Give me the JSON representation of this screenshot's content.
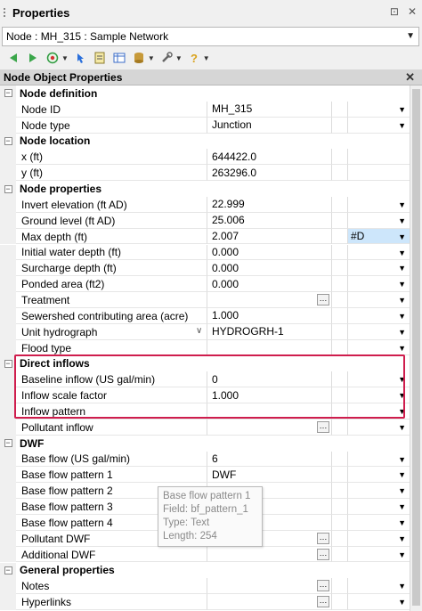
{
  "panel": {
    "title": "Properties",
    "pin_glyph": "⊡",
    "close_glyph": "✕"
  },
  "node_selector": {
    "value": "Node : MH_315 : Sample Network"
  },
  "toolbar": {
    "icons": [
      "back-icon",
      "forward-icon",
      "record-icon",
      "pointer-icon",
      "note-icon",
      "table-icon",
      "database-icon",
      "wrench-icon",
      "help-icon"
    ]
  },
  "grid_header": {
    "label": "Node Object Properties",
    "close_glyph": "✕"
  },
  "groups": {
    "node_definition": "Node definition",
    "node_location": "Node location",
    "node_properties": "Node properties",
    "direct_inflows": "Direct inflows",
    "dwf": "DWF",
    "general_properties": "General properties"
  },
  "props": {
    "node_id": {
      "name": "Node ID",
      "value": "MH_315"
    },
    "node_type": {
      "name": "Node type",
      "value": "Junction"
    },
    "x": {
      "name": "x (ft)",
      "value": "644422.0"
    },
    "y": {
      "name": "y (ft)",
      "value": "263296.0"
    },
    "invert": {
      "name": "Invert elevation (ft AD)",
      "value": "22.999"
    },
    "ground": {
      "name": "Ground level (ft AD)",
      "value": "25.006"
    },
    "maxdepth": {
      "name": "Max depth (ft)",
      "value": "2.007",
      "flag": "#D"
    },
    "initdepth": {
      "name": "Initial water depth (ft)",
      "value": "0.000"
    },
    "surcharge": {
      "name": "Surcharge depth (ft)",
      "value": "0.000"
    },
    "ponded": {
      "name": "Ponded area (ft2)",
      "value": "0.000"
    },
    "treatment": {
      "name": "Treatment",
      "value": ""
    },
    "sewershed": {
      "name": "Sewershed contributing area (acre)",
      "value": "1.000"
    },
    "unithydro": {
      "name": "Unit hydrograph",
      "value": "HYDROGRH-1"
    },
    "floodtype": {
      "name": "Flood type",
      "value": ""
    },
    "baseline": {
      "name": "Baseline inflow (US gal/min)",
      "value": "0"
    },
    "scale": {
      "name": "Inflow scale factor",
      "value": "1.000"
    },
    "pattern": {
      "name": "Inflow pattern",
      "value": ""
    },
    "pollutant": {
      "name": "Pollutant inflow",
      "value": ""
    },
    "baseflow": {
      "name": "Base flow (US gal/min)",
      "value": "6"
    },
    "bfp1": {
      "name": "Base flow pattern 1",
      "value": "DWF"
    },
    "bfp2": {
      "name": "Base flow pattern 2",
      "value": ""
    },
    "bfp3": {
      "name": "Base flow pattern 3",
      "value": ""
    },
    "bfp4": {
      "name": "Base flow pattern 4",
      "value": ""
    },
    "polldwf": {
      "name": "Pollutant DWF",
      "value": ""
    },
    "adddwf": {
      "name": "Additional DWF",
      "value": ""
    },
    "notes": {
      "name": "Notes",
      "value": ""
    },
    "hyperlinks": {
      "name": "Hyperlinks",
      "value": ""
    }
  },
  "tooltip": {
    "line1": "Base flow pattern 1",
    "line2": "Field: bf_pattern_1",
    "line3": "Type: Text",
    "line4": "Length: 254"
  },
  "colors": {
    "highlight": "#cf1d4d",
    "selected_cell": "#cde6fb"
  }
}
